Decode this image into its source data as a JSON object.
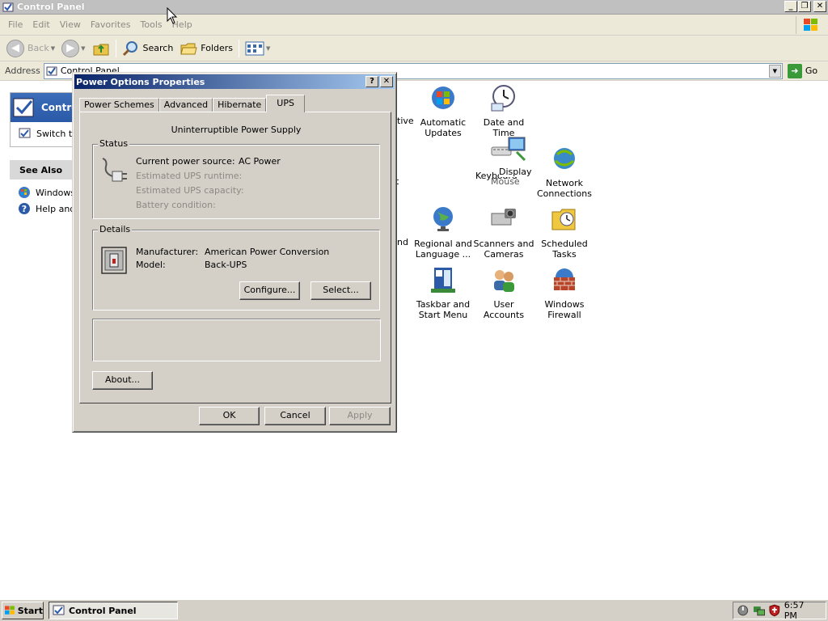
{
  "window": {
    "title": "Control Panel",
    "buttons": [
      "minimize",
      "restore",
      "close"
    ]
  },
  "menubar": {
    "items": [
      "File",
      "Edit",
      "View",
      "Favorites",
      "Tools",
      "Help"
    ]
  },
  "toolbar": {
    "back_label": "Back",
    "search_label": "Search",
    "folders_label": "Folders"
  },
  "address": {
    "label": "Address",
    "value": "Control Panel",
    "go_label": "Go"
  },
  "left_pane": {
    "control_panel_title": "Control",
    "switch_link": "Switch to",
    "see_also_title": "See Also",
    "see_also_items": [
      "Windows",
      "Help and"
    ]
  },
  "icons": [
    {
      "label": "Automatic Updates",
      "icon": "automatic-updates-icon"
    },
    {
      "label": "Date and Time",
      "icon": "clock-icon"
    },
    {
      "label": "Keyboard",
      "icon": "keyboard-icon"
    },
    {
      "label": "Display",
      "icon": "display-icon"
    },
    {
      "label": "Mouse",
      "icon": "mouse-icon"
    },
    {
      "label": "Network Connections",
      "icon": "network-icon"
    },
    {
      "label": "Regional and Language ...",
      "icon": "globe-icon"
    },
    {
      "label": "Scanners and Cameras",
      "icon": "scanner-icon"
    },
    {
      "label": "Scheduled Tasks",
      "icon": "scheduled-tasks-icon"
    },
    {
      "label": "Taskbar and Start Menu",
      "icon": "taskbar-icon"
    },
    {
      "label": "User Accounts",
      "icon": "user-accounts-icon"
    },
    {
      "label": "Windows Firewall",
      "icon": "firewall-icon"
    }
  ],
  "partial_labels": [
    "tive",
    "t",
    "nd"
  ],
  "dialog": {
    "title": "Power Options Properties",
    "tabs": [
      "Power Schemes",
      "Advanced",
      "Hibernate",
      "UPS"
    ],
    "active_tab": "UPS",
    "ups_title": "Uninterruptible Power Supply",
    "status": {
      "legend": "Status",
      "current_source_label": "Current power source:",
      "current_source_value": "AC Power",
      "runtime_label": "Estimated UPS runtime:",
      "capacity_label": "Estimated UPS capacity:",
      "battery_label": "Battery condition:"
    },
    "details": {
      "legend": "Details",
      "manufacturer_label": "Manufacturer:",
      "manufacturer_value": "American Power Conversion",
      "model_label": "Model:",
      "model_value": "Back-UPS",
      "configure_label": "Configure...",
      "select_label": "Select..."
    },
    "about_label": "About...",
    "ok_label": "OK",
    "cancel_label": "Cancel",
    "apply_label": "Apply"
  },
  "taskbar": {
    "start_label": "Start",
    "task_label": "Control Panel",
    "time": "6:57 PM"
  }
}
